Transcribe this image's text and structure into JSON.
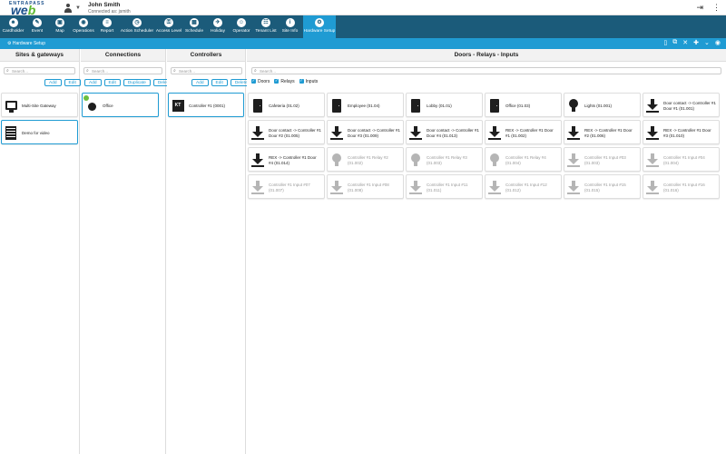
{
  "app": {
    "logo_top": "ENTRAPASS",
    "logo_main_a": "we",
    "logo_main_b": "b"
  },
  "user": {
    "name": "John Smith",
    "status": "Connected as: jsmith"
  },
  "nav": [
    {
      "label": "Cardholder",
      "icon": "cardholder-icon",
      "glyph": "☻"
    },
    {
      "label": "Event",
      "icon": "event-icon",
      "glyph": "✎"
    },
    {
      "label": "Map",
      "icon": "map-icon",
      "glyph": "▣"
    },
    {
      "label": "Operations",
      "icon": "operations-icon",
      "glyph": "◉"
    },
    {
      "label": "Report",
      "icon": "report-icon",
      "glyph": "≡"
    },
    {
      "label": "Action Scheduler",
      "icon": "action-scheduler-icon",
      "glyph": "◷"
    },
    {
      "label": "Access Level",
      "icon": "access-level-icon",
      "glyph": "⚿"
    },
    {
      "label": "Schedule",
      "icon": "schedule-icon",
      "glyph": "▦"
    },
    {
      "label": "Holiday",
      "icon": "holiday-icon",
      "glyph": "✈"
    },
    {
      "label": "Operator",
      "icon": "operator-icon",
      "glyph": "☺"
    },
    {
      "label": "Tenant List",
      "icon": "tenant-list-icon",
      "glyph": "☷"
    },
    {
      "label": "Site Info",
      "icon": "site-info-icon",
      "glyph": "i"
    },
    {
      "label": "Hardware Setup",
      "icon": "hardware-setup-icon",
      "glyph": "⚙"
    }
  ],
  "subbar": {
    "title": "Hardware Setup"
  },
  "panels": {
    "sites": {
      "title": "Sites & gateways",
      "search_placeholder": "Search...",
      "add": "Add",
      "edit": "Edit",
      "items": [
        {
          "label": "Multi-Site Gateway",
          "icon": "gateway-icon"
        },
        {
          "label": "Demo for video",
          "icon": "site-icon"
        }
      ]
    },
    "connections": {
      "title": "Connections",
      "search_placeholder": "Search...",
      "add": "Add",
      "edit": "Edit",
      "duplicate": "Duplicate",
      "delete": "Delete",
      "items": [
        {
          "label": "Office",
          "icon": "connection-icon"
        }
      ]
    },
    "controllers": {
      "title": "Controllers",
      "search_placeholder": "Search...",
      "add": "Add",
      "edit": "Edit",
      "delete": "Delete",
      "items": [
        {
          "label": "Controller #1 (0001)",
          "icon": "controller-icon",
          "badge": "KT"
        }
      ]
    },
    "doors": {
      "title": "Doors - Relays - Inputs",
      "search_placeholder": "Search...",
      "filters": [
        "Doors",
        "Relays",
        "Inputs"
      ],
      "items": [
        {
          "label": "Cafeteria (01.02)",
          "type": "door"
        },
        {
          "label": "Employee (01.04)",
          "type": "door"
        },
        {
          "label": "Lobby (01.01)",
          "type": "door"
        },
        {
          "label": "Office (01.03)",
          "type": "door"
        },
        {
          "label": "Lights (01.001)",
          "type": "bulb"
        },
        {
          "label": "Door contact -> Controller #1 Door #1 (01.001)",
          "type": "arrow"
        },
        {
          "label": "Door contact -> Controller #1 Door #2 (01.005)",
          "type": "arrow"
        },
        {
          "label": "Door contact -> Controller #1 Door #3 (01.009)",
          "type": "arrow"
        },
        {
          "label": "Door contact -> Controller #1 Door #4 (01.013)",
          "type": "arrow"
        },
        {
          "label": "REX -> Controller #1 Door #1 (01.002)",
          "type": "arrow"
        },
        {
          "label": "REX -> Controller #1 Door #2 (01.006)",
          "type": "arrow"
        },
        {
          "label": "REX -> Controller #1 Door #3 (01.010)",
          "type": "arrow"
        },
        {
          "label": "REX -> Controller #1 Door #4 (01.014)",
          "type": "arrow"
        },
        {
          "label": "Controller #1 Relay #2 (01.002)",
          "type": "bulb-grey"
        },
        {
          "label": "Controller #1 Relay #3 (01.003)",
          "type": "bulb-grey"
        },
        {
          "label": "Controller #1 Relay #4 (01.004)",
          "type": "bulb-grey"
        },
        {
          "label": "Controller #1 Input #03 (01.003)",
          "type": "arrow-grey"
        },
        {
          "label": "Controller #1 Input #04 (01.004)",
          "type": "arrow-grey"
        },
        {
          "label": "Controller #1 Input #07 (01.007)",
          "type": "arrow-grey"
        },
        {
          "label": "Controller #1 Input #08 (01.008)",
          "type": "arrow-grey"
        },
        {
          "label": "Controller #1 Input #11 (01.011)",
          "type": "arrow-grey"
        },
        {
          "label": "Controller #1 Input #12 (01.012)",
          "type": "arrow-grey"
        },
        {
          "label": "Controller #1 Input #15 (01.015)",
          "type": "arrow-grey"
        },
        {
          "label": "Controller #1 Input #16 (01.016)",
          "type": "arrow-grey"
        }
      ]
    }
  },
  "colors": {
    "navbar": "#1b5b7a",
    "accent": "#1f9bd3"
  }
}
